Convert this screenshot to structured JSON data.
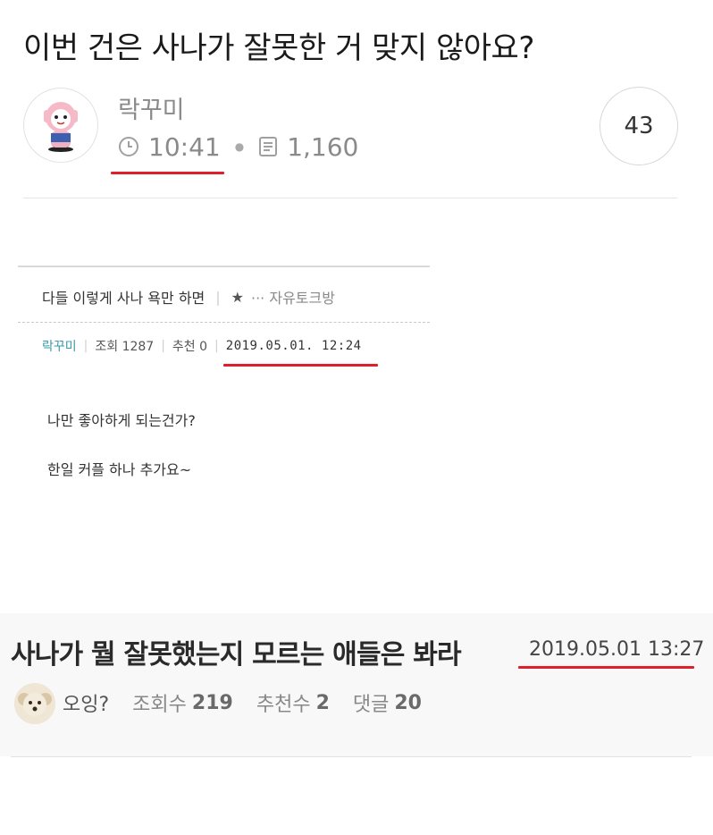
{
  "post": {
    "title": "이번 건은 사나가 잘못한 거 맞지 않아요?",
    "author": "락꾸미",
    "time": "10:41",
    "views": "1,160",
    "comment_count": "43"
  },
  "embed1": {
    "title": "다들 이렇게 사나 욕만 하면",
    "star": "★",
    "board": "··· 자유토크방",
    "writer": "락꾸미",
    "views": "조회 1287",
    "likes": "추천 0",
    "date": "2019.05.01. 12:24",
    "body": [
      "나만 좋아하게 되는건가?",
      "한일 커플 하나 추가요~"
    ]
  },
  "embed2": {
    "title": "사나가 뭘 잘못했는지 모르는 애들은 봐라",
    "date": "2019.05.01 13:27",
    "nick": "오잉?",
    "views_label": "조회수",
    "views": "219",
    "likes_label": "추천수",
    "likes": "2",
    "comments_label": "댓글",
    "comments": "20"
  },
  "colors": {
    "underline": "#e01f2c",
    "writer": "#3a9aa7"
  },
  "icons": [
    "clock-icon",
    "document-icon",
    "cartoon-avatar",
    "dog-avatar"
  ]
}
